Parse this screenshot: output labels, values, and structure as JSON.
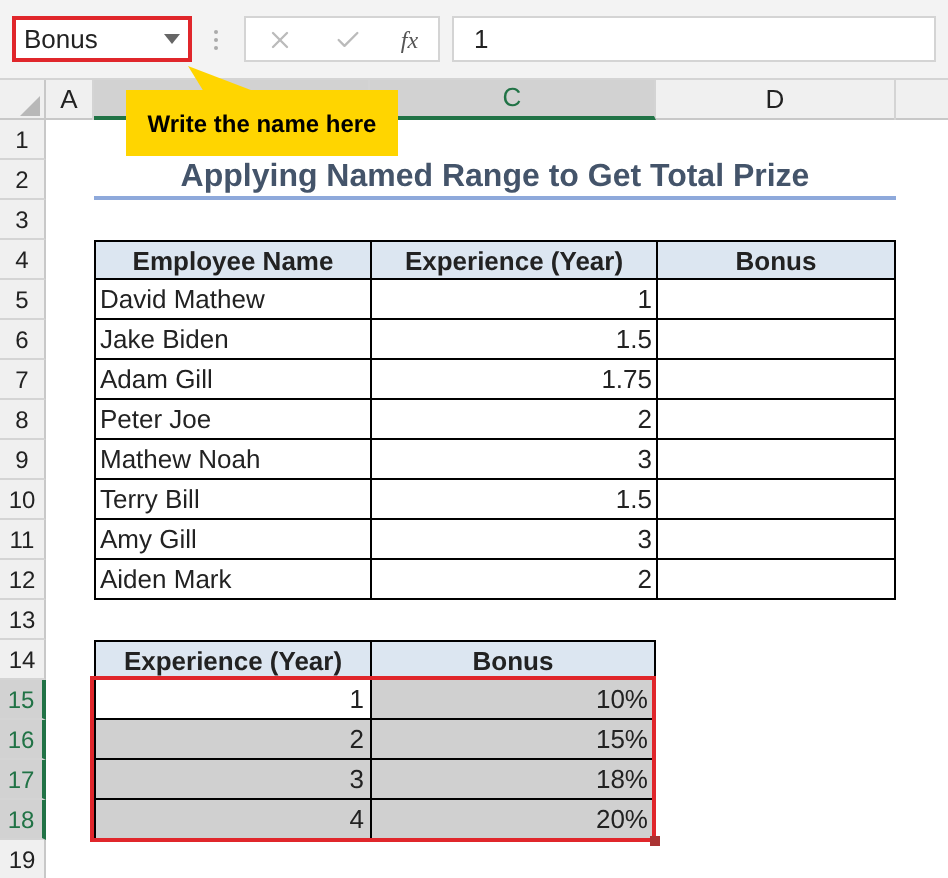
{
  "name_box": {
    "value": "Bonus"
  },
  "formula_bar": {
    "function_label": "fx",
    "value": "1"
  },
  "callout": "Write the name here",
  "columns": [
    {
      "label": "A",
      "selected": false
    },
    {
      "selected": true
    },
    {
      "label": "C",
      "selected": true
    },
    {
      "label": "D",
      "selected": false
    }
  ],
  "rows": [
    {
      "label": "1",
      "selected": false
    },
    {
      "label": "2",
      "selected": false
    },
    {
      "label": "3",
      "selected": false
    },
    {
      "label": "4",
      "selected": false
    },
    {
      "label": "5",
      "selected": false
    },
    {
      "label": "6",
      "selected": false
    },
    {
      "label": "7",
      "selected": false
    },
    {
      "label": "8",
      "selected": false
    },
    {
      "label": "9",
      "selected": false
    },
    {
      "label": "10",
      "selected": false
    },
    {
      "label": "11",
      "selected": false
    },
    {
      "label": "12",
      "selected": false
    },
    {
      "label": "13",
      "selected": false
    },
    {
      "label": "14",
      "selected": false
    },
    {
      "label": "15",
      "selected": true
    },
    {
      "label": "16",
      "selected": true
    },
    {
      "label": "17",
      "selected": true
    },
    {
      "label": "18",
      "selected": true
    },
    {
      "label": "19",
      "selected": false
    }
  ],
  "title": "Applying Named Range to Get Total Prize",
  "employee_table": {
    "columns": [
      "Employee Name",
      "Experience (Year)",
      "Bonus"
    ],
    "rows": [
      {
        "name": "David Mathew",
        "experience": "1"
      },
      {
        "name": "Jake Biden",
        "experience": "1.5"
      },
      {
        "name": "Adam Gill",
        "experience": "1.75"
      },
      {
        "name": "Peter Joe",
        "experience": "2"
      },
      {
        "name": "Mathew Noah",
        "experience": "3"
      },
      {
        "name": "Terry Bill",
        "experience": "1.5"
      },
      {
        "name": "Amy Gill",
        "experience": "3"
      },
      {
        "name": "Aiden Mark",
        "experience": "2"
      }
    ]
  },
  "bonus_table": {
    "columns": [
      "Experience (Year)",
      "Bonus"
    ],
    "rows": [
      {
        "experience": "1",
        "bonus": "10%",
        "selected": true,
        "active": true
      },
      {
        "experience": "2",
        "bonus": "15%",
        "selected": true,
        "active": false
      },
      {
        "experience": "3",
        "bonus": "18%",
        "selected": true,
        "active": false
      },
      {
        "experience": "4",
        "bonus": "20%",
        "selected": true,
        "active": false
      }
    ]
  }
}
